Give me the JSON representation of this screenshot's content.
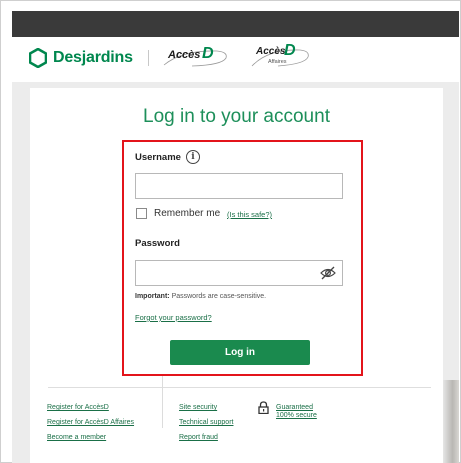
{
  "header": {
    "brand": "Desjardins",
    "accesd_logo": "Accès",
    "accesd_logo_d": "D",
    "accesd_affaires_logo": "Accès",
    "accesd_affaires_logo_d": "D",
    "accesd_affaires_logo_sub": "Affaires"
  },
  "login": {
    "title": "Log in to your account",
    "username_label": "Username",
    "username_value": "",
    "remember_me_label": "Remember me",
    "is_this_safe_link": "(Is this safe?)",
    "password_label": "Password",
    "password_value": "",
    "important_label": "Important:",
    "important_text": "Passwords are case-sensitive.",
    "forgot_password_link": "Forgot your password?",
    "login_button": "Log in"
  },
  "footer": {
    "col1": [
      "Register for AccèsD",
      "Register for AccèsD Affaires",
      "Become a member"
    ],
    "col2": [
      "Site security",
      "Technical support",
      "Report fraud"
    ],
    "guarantee": [
      "Guaranteed",
      "100% secure"
    ]
  },
  "icons": {
    "brand": "desjardins-hexagon-icon",
    "info": "info-icon",
    "eye": "eye-slash-icon",
    "lock": "lock-icon"
  },
  "colors": {
    "brand_green": "#00874e",
    "title_green": "#1d8f5a",
    "button_green": "#1a8a4e",
    "highlight_red": "#e3141b"
  }
}
